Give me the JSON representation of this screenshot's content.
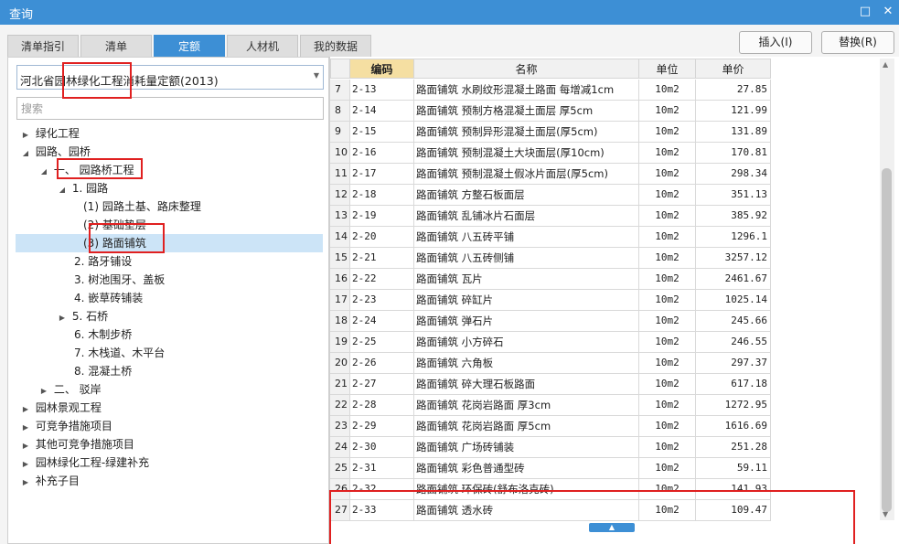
{
  "window": {
    "title": "查询"
  },
  "tabs": [
    {
      "label": "清单指引"
    },
    {
      "label": "清单"
    },
    {
      "label": "定额"
    },
    {
      "label": "人材机"
    },
    {
      "label": "我的数据"
    }
  ],
  "actions": {
    "insert_label": "插入(I)",
    "replace_label": "替换(R)"
  },
  "left": {
    "library": "河北省园林绿化工程消耗量定额(2013)",
    "search_placeholder": "搜索",
    "tree": [
      {
        "label": "绿化工程"
      },
      {
        "label": "园路、园桥"
      },
      {
        "label": "一、 园路桥工程"
      },
      {
        "label": "1. 园路"
      },
      {
        "label": "(1) 园路土基、路床整理"
      },
      {
        "label": "(2) 基础垫层"
      },
      {
        "label": "(3) 路面铺筑"
      },
      {
        "label": "2. 路牙铺设"
      },
      {
        "label": "3. 树池围牙、盖板"
      },
      {
        "label": "4. 嵌草砖铺装"
      },
      {
        "label": "5. 石桥"
      },
      {
        "label": "6. 木制步桥"
      },
      {
        "label": "7. 木栈道、木平台"
      },
      {
        "label": "8. 混凝土桥"
      },
      {
        "label": "二、 驳岸"
      },
      {
        "label": "园林景观工程"
      },
      {
        "label": "可竞争措施项目"
      },
      {
        "label": "其他可竞争措施项目"
      },
      {
        "label": "园林绿化工程-绿建补充"
      },
      {
        "label": "补充子目"
      }
    ]
  },
  "grid": {
    "headers": {
      "code": "编码",
      "name": "名称",
      "unit": "单位",
      "price": "单价"
    },
    "rows": [
      {
        "idx": "7",
        "code": "2-13",
        "name": "路面铺筑 水刷纹形混凝土路面 每增减1cm",
        "unit": "10m2",
        "price": "27.85"
      },
      {
        "idx": "8",
        "code": "2-14",
        "name": "路面铺筑 预制方格混凝土面层 厚5cm",
        "unit": "10m2",
        "price": "121.99"
      },
      {
        "idx": "9",
        "code": "2-15",
        "name": "路面铺筑 预制异形混凝土面层(厚5cm)",
        "unit": "10m2",
        "price": "131.89"
      },
      {
        "idx": "10",
        "code": "2-16",
        "name": "路面铺筑 预制混凝土大块面层(厚10cm)",
        "unit": "10m2",
        "price": "170.81"
      },
      {
        "idx": "11",
        "code": "2-17",
        "name": "路面铺筑 预制混凝土假冰片面层(厚5cm)",
        "unit": "10m2",
        "price": "298.34"
      },
      {
        "idx": "12",
        "code": "2-18",
        "name": "路面铺筑 方整石板面层",
        "unit": "10m2",
        "price": "351.13"
      },
      {
        "idx": "13",
        "code": "2-19",
        "name": "路面铺筑 乱铺冰片石面层",
        "unit": "10m2",
        "price": "385.92"
      },
      {
        "idx": "14",
        "code": "2-20",
        "name": "路面铺筑 八五砖平铺",
        "unit": "10m2",
        "price": "1296.1"
      },
      {
        "idx": "15",
        "code": "2-21",
        "name": "路面铺筑 八五砖侧铺",
        "unit": "10m2",
        "price": "3257.12"
      },
      {
        "idx": "16",
        "code": "2-22",
        "name": "路面铺筑 瓦片",
        "unit": "10m2",
        "price": "2461.67"
      },
      {
        "idx": "17",
        "code": "2-23",
        "name": "路面铺筑 碎缸片",
        "unit": "10m2",
        "price": "1025.14"
      },
      {
        "idx": "18",
        "code": "2-24",
        "name": "路面铺筑 弹石片",
        "unit": "10m2",
        "price": "245.66"
      },
      {
        "idx": "19",
        "code": "2-25",
        "name": "路面铺筑 小方碎石",
        "unit": "10m2",
        "price": "246.55"
      },
      {
        "idx": "20",
        "code": "2-26",
        "name": "路面铺筑 六角板",
        "unit": "10m2",
        "price": "297.37"
      },
      {
        "idx": "21",
        "code": "2-27",
        "name": "路面铺筑 碎大理石板路面",
        "unit": "10m2",
        "price": "617.18"
      },
      {
        "idx": "22",
        "code": "2-28",
        "name": "路面铺筑 花岗岩路面 厚3cm",
        "unit": "10m2",
        "price": "1272.95"
      },
      {
        "idx": "23",
        "code": "2-29",
        "name": "路面铺筑 花岗岩路面 厚5cm",
        "unit": "10m2",
        "price": "1616.69"
      },
      {
        "idx": "24",
        "code": "2-30",
        "name": "路面铺筑 广场砖铺装",
        "unit": "10m2",
        "price": "251.28"
      },
      {
        "idx": "25",
        "code": "2-31",
        "name": "路面铺筑 彩色普通型砖",
        "unit": "10m2",
        "price": "59.11"
      },
      {
        "idx": "26",
        "code": "2-32",
        "name": "路面铺筑 环保砖(舒布洛克砖)",
        "unit": "10m2",
        "price": "141.93"
      },
      {
        "idx": "27",
        "code": "2-33",
        "name": "路面铺筑 透水砖",
        "unit": "10m2",
        "price": "109.47"
      }
    ]
  },
  "colors": {
    "accent": "#3d8fd5",
    "selected": "#cce4f7",
    "code_header": "#f5dfa2",
    "annotation": "#e02020"
  },
  "icons": {
    "maximize": "maximize-icon",
    "close": "close-icon",
    "expanded": "triangle-expanded-icon",
    "collapsed": "triangle-collapsed-icon"
  }
}
